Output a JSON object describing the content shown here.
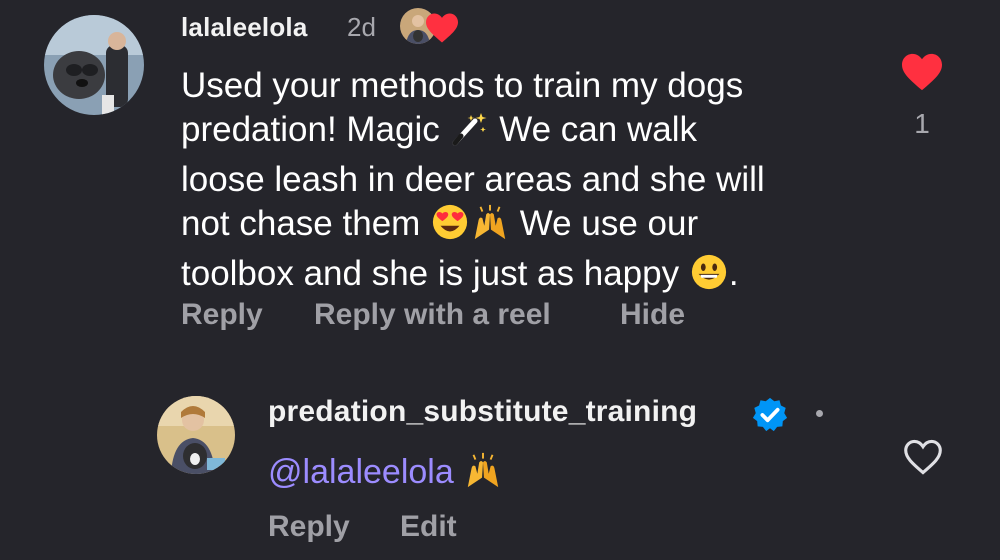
{
  "comment": {
    "username": "lalaleelola",
    "timestamp": "2d",
    "line1": "Used your methods to train my dogs",
    "line2_a": "predation! Magic ",
    "line2_b": " We can walk",
    "line3": "loose leash in deer areas and she will",
    "line4_a": "not chase them ",
    "line4_b": " We use our",
    "line5_a": "toolbox and she is just as happy ",
    "line5_b": ".",
    "like_count": "1",
    "actions": {
      "reply": "Reply",
      "reply_with_reel": "Reply with a reel",
      "hide": "Hide"
    },
    "emojis": {
      "magic": "magic-wand-icon",
      "heart_eyes": "heart-eyes-icon",
      "raised_hands": "raised-hands-icon",
      "smile": "grinning-face-icon"
    }
  },
  "reply": {
    "username": "predation_substitute_training",
    "mention": "@lalaleelola",
    "actions": {
      "reply": "Reply",
      "edit": "Edit"
    }
  },
  "colors": {
    "background": "#25252b",
    "heart_liked": "#ff3040",
    "verified": "#0095f6",
    "mention": "#9c8cff",
    "secondary_text": "#a8a8ae"
  }
}
